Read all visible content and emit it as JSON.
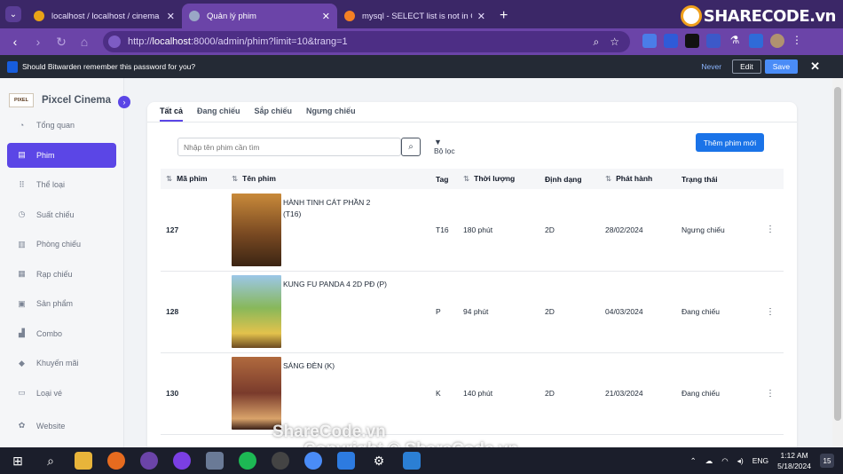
{
  "browser": {
    "tabs": [
      {
        "title": "localhost / localhost / cinema /",
        "favicon_color": "#e8a317",
        "active": false
      },
      {
        "title": "Quản lý phim",
        "favicon_color": "#9aa7c6",
        "active": true
      },
      {
        "title": "mysql - SELECT list is not in GR",
        "favicon_color": "#f48024",
        "active": false
      }
    ],
    "url_prefix": "http://",
    "url_host": "localhost",
    "url_rest": ":8000/admin/phim?limit=10&trang=1",
    "logo_text": "SHARECODE.vn"
  },
  "password_bar": {
    "message": "Should Bitwarden remember this password for you?",
    "never": "Never",
    "edit": "Edit",
    "save": "Save"
  },
  "sidebar": {
    "brand_logo": "PIXEL",
    "brand_name": "Pixcel Cinema",
    "items": [
      {
        "label": "Tổng quan",
        "icon": "pie-chart-icon",
        "glyph": "◔"
      },
      {
        "label": "Phim",
        "icon": "film-icon",
        "glyph": "▤",
        "active": true
      },
      {
        "label": "Thể loại",
        "icon": "grid-icon",
        "glyph": "⠿"
      },
      {
        "label": "Suất chiếu",
        "icon": "clock-icon",
        "glyph": "◷"
      },
      {
        "label": "Phòng chiếu",
        "icon": "building-icon",
        "glyph": "▥"
      },
      {
        "label": "Rạp chiếu",
        "icon": "theater-icon",
        "glyph": "▦"
      },
      {
        "label": "Sản phẩm",
        "icon": "box-icon",
        "glyph": "▣"
      },
      {
        "label": "Combo",
        "icon": "combo-icon",
        "glyph": "▟"
      },
      {
        "label": "Khuyến mãi",
        "icon": "tag-icon",
        "glyph": "◆"
      },
      {
        "label": "Loại vé",
        "icon": "ticket-icon",
        "glyph": "▭"
      },
      {
        "label": "Website",
        "icon": "gear-icon",
        "glyph": "✿"
      }
    ]
  },
  "filter_tabs": [
    "Tất cả",
    "Đang chiếu",
    "Sắp chiếu",
    "Ngưng chiếu"
  ],
  "search": {
    "placeholder": "Nhập tên phim cần tìm"
  },
  "filter_label": "Bộ lọc",
  "add_button": "Thêm phim mới",
  "table": {
    "columns": [
      "Mã phim",
      "Tên phim",
      "Tag",
      "Thời lượng",
      "Định dạng",
      "Phát hành",
      "Trạng thái"
    ],
    "sortable": [
      true,
      true,
      false,
      true,
      false,
      true,
      false
    ],
    "rows": [
      {
        "id": "127",
        "name": "HÀNH TINH CÁT PHẦN 2 (T16)",
        "tag": "T16",
        "duration": "180 phút",
        "format": "2D",
        "release": "28/02/2024",
        "status": "Ngưng chiếu",
        "poster": [
          "#c98a3a",
          "#3b2413"
        ]
      },
      {
        "id": "128",
        "name": "KUNG FU PANDA 4 2D PĐ (P)",
        "tag": "P",
        "duration": "94 phút",
        "format": "2D",
        "release": "04/03/2024",
        "status": "Đang chiếu",
        "poster": [
          "#88b85a",
          "#e3c24c"
        ]
      },
      {
        "id": "130",
        "name": "SÁNG ĐÈN (K)",
        "tag": "K",
        "duration": "140 phút",
        "format": "2D",
        "release": "21/03/2024",
        "status": "Đang chiếu",
        "poster": [
          "#7a3b2c",
          "#d9a36a"
        ]
      }
    ]
  },
  "watermark": {
    "line1": "ShareCode.vn",
    "line2": "Copyright © ShareCode.vn"
  },
  "taskbar": {
    "language": "ENG",
    "time": "1:12 AM",
    "date": "5/18/2024",
    "notifications": "15"
  }
}
